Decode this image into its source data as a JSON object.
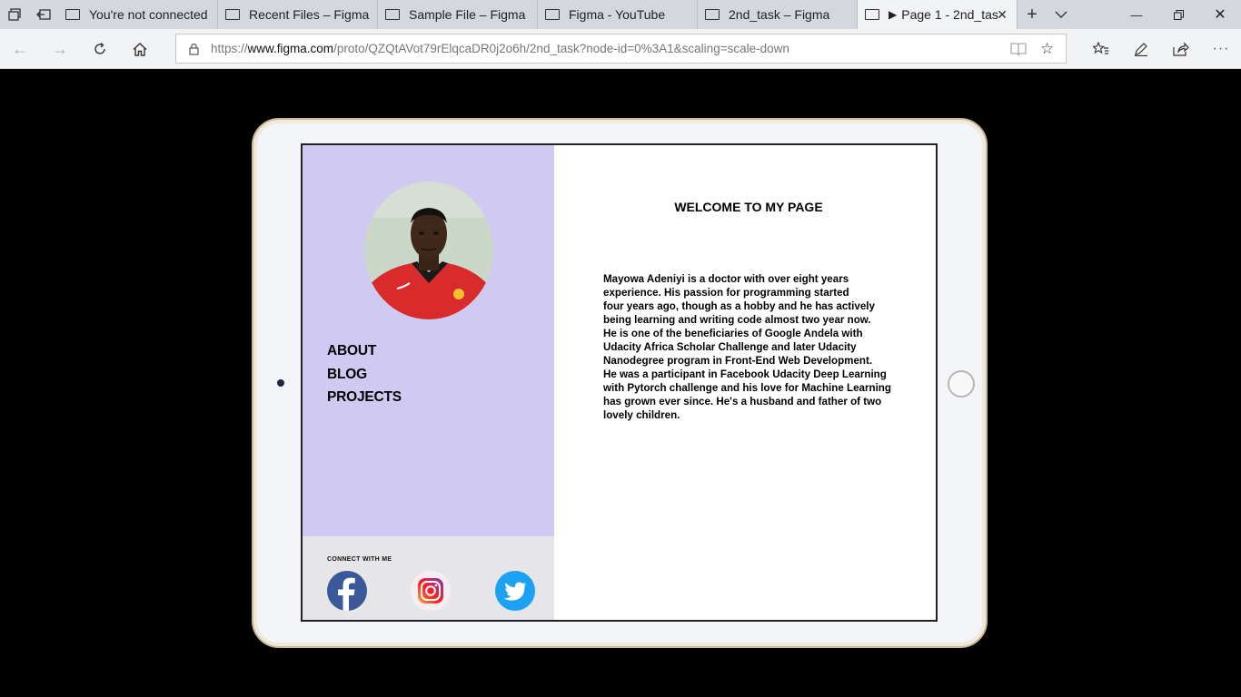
{
  "browser": {
    "tabs": [
      {
        "label": "You're not connected"
      },
      {
        "label": "Recent Files – Figma"
      },
      {
        "label": "Sample File – Figma"
      },
      {
        "label": "Figma - YouTube"
      },
      {
        "label": "2nd_task – Figma"
      },
      {
        "label": "Page 1 - 2nd_tas",
        "active": true
      }
    ],
    "url_prefix": "https://",
    "url_host": "www.figma.com",
    "url_path": "/proto/QZQtAVot79rElqcaDR0j2o6h/2nd_task?node-id=0%3A1&scaling=scale-down"
  },
  "page": {
    "nav": [
      "ABOUT",
      "BLOG",
      "PROJECTS"
    ],
    "connect_label": "CONNECT  WITH  ME",
    "social": [
      "facebook-icon",
      "instagram-icon",
      "twitter-icon"
    ],
    "welcome": "WELCOME TO MY PAGE",
    "bio_lines": [
      "Mayowa Adeniyi is a doctor with over eight years",
      "experience.  His passion for programming started",
      "four years ago, though as a hobby and  he has actively",
      "being learning and writing code almost two year now.",
      "He is one of the beneficiaries of Google Andela with",
      "Udacity Africa Scholar Challenge and later Udacity",
      "Nanodegree program in Front-End Web Development.",
      "He was a participant in Facebook Udacity Deep Learning",
      "with Pytorch challenge and his love for Machine Learning",
      "has grown ever since. He's a husband and father of two",
      "lovely children."
    ]
  },
  "colors": {
    "sidebar": "#d0caf3",
    "connect_panel": "#e6e6e8",
    "facebook": "#3b5998",
    "twitter": "#1da1f2"
  }
}
